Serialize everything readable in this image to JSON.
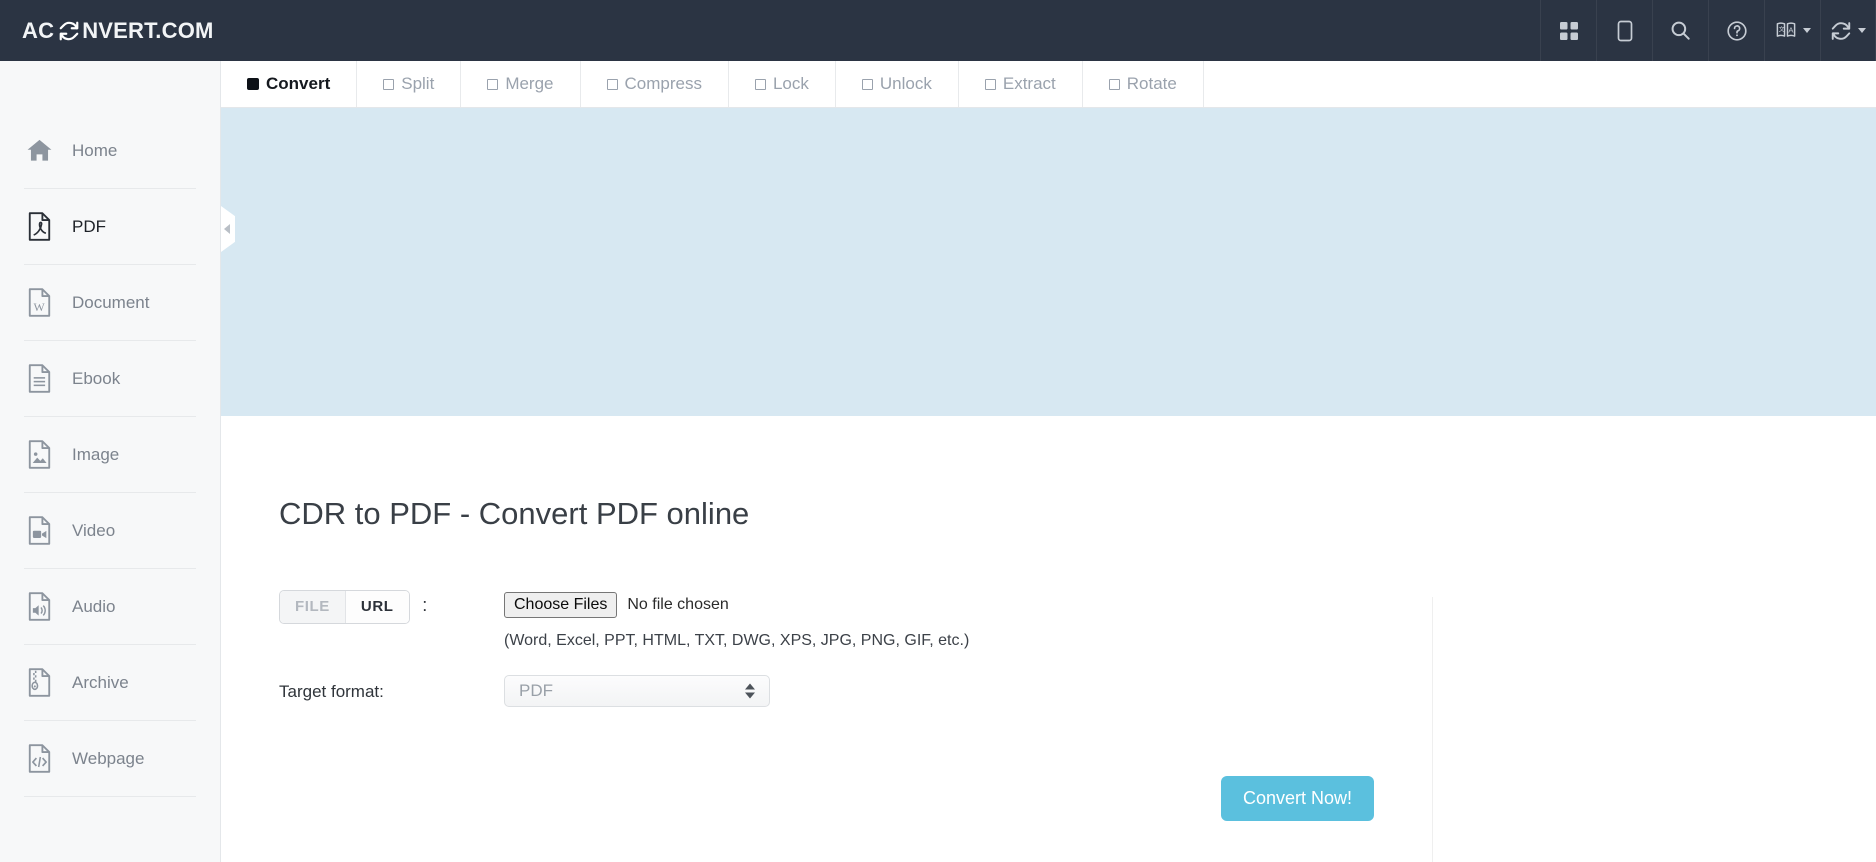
{
  "header": {
    "logo_prefix": "AC",
    "logo_icon": "refresh-convert-icon",
    "logo_suffix": "NVERT.COM",
    "icons": [
      {
        "name": "apps-grid-icon",
        "label": "Apps"
      },
      {
        "name": "mobile-device-icon",
        "label": "Mobile"
      },
      {
        "name": "search-icon",
        "label": "Search"
      },
      {
        "name": "help-question-icon",
        "label": "Help"
      },
      {
        "name": "language-translate-icon",
        "label": "Language"
      },
      {
        "name": "convert-refresh-icon",
        "label": "Convert"
      }
    ],
    "bg_color": "#2b3443"
  },
  "tabs": [
    {
      "label": "Convert",
      "active": true
    },
    {
      "label": "Split",
      "active": false
    },
    {
      "label": "Merge",
      "active": false
    },
    {
      "label": "Compress",
      "active": false
    },
    {
      "label": "Lock",
      "active": false
    },
    {
      "label": "Unlock",
      "active": false
    },
    {
      "label": "Extract",
      "active": false
    },
    {
      "label": "Rotate",
      "active": false
    }
  ],
  "sidebar": {
    "items": [
      {
        "label": "Home",
        "icon": "home-icon",
        "active": false
      },
      {
        "label": "PDF",
        "icon": "pdf-file-icon",
        "active": true
      },
      {
        "label": "Document",
        "icon": "word-document-icon",
        "active": false
      },
      {
        "label": "Ebook",
        "icon": "ebook-file-icon",
        "active": false
      },
      {
        "label": "Image",
        "icon": "image-file-icon",
        "active": false
      },
      {
        "label": "Video",
        "icon": "video-file-icon",
        "active": false
      },
      {
        "label": "Audio",
        "icon": "audio-file-icon",
        "active": false
      },
      {
        "label": "Archive",
        "icon": "archive-zip-icon",
        "active": false
      },
      {
        "label": "Webpage",
        "icon": "webpage-code-icon",
        "active": false
      }
    ],
    "collapse_handle_icon": "chevron-left-icon",
    "bg_color": "#f7f8f9"
  },
  "banner": {
    "bg_color": "#d7e8f2"
  },
  "main": {
    "title": "CDR to PDF - Convert PDF online",
    "source_row": {
      "label": "",
      "segment_file": "FILE",
      "segment_url": "URL",
      "colon": ":",
      "choose_files_label": "Choose Files",
      "no_file_chosen": "No file chosen",
      "hint": "(Word, Excel, PPT, HTML, TXT, DWG, XPS, JPG, PNG, GIF, etc.)"
    },
    "target_row": {
      "label": "Target format:",
      "selected_value": "PDF"
    },
    "convert_button": {
      "label": "Convert Now!",
      "color": "#5bc0de"
    }
  }
}
